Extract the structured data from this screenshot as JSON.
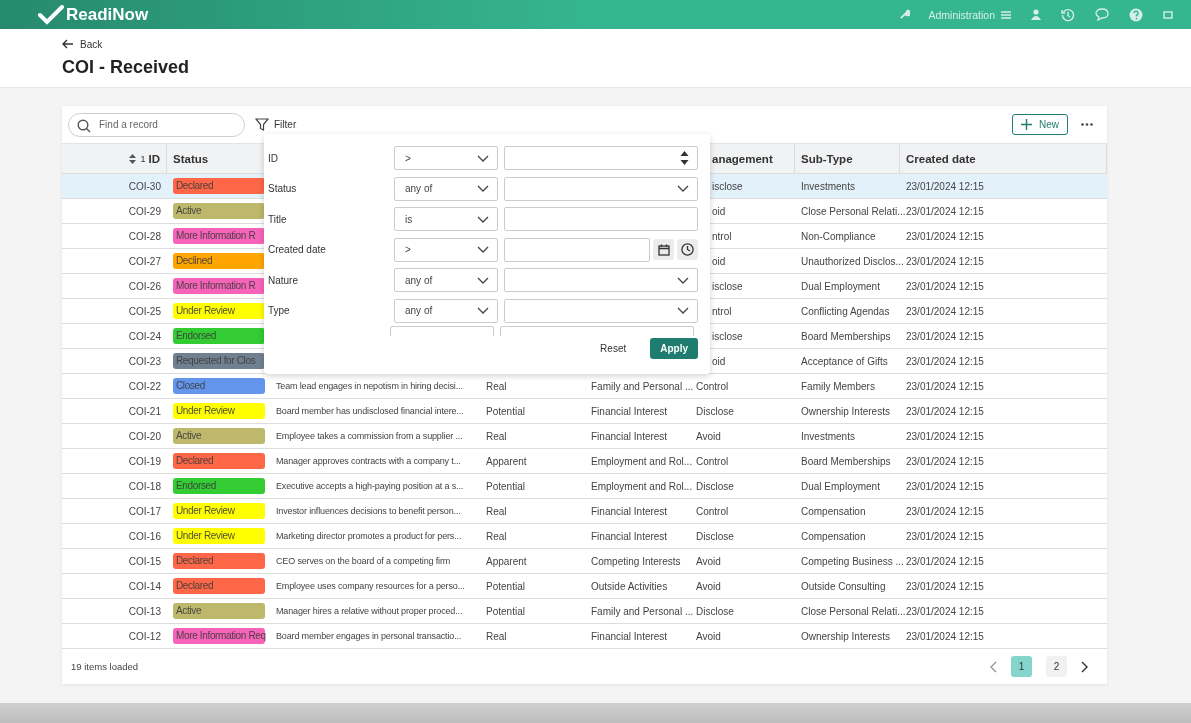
{
  "app": {
    "logo": "ReadiNow",
    "admin_label": "Administration"
  },
  "page": {
    "back": "Back",
    "title": "COI - Received"
  },
  "toolbar": {
    "search_placeholder": "Find a record",
    "filter": "Filter",
    "new": "New"
  },
  "table": {
    "sort_rank": "1",
    "headings": {
      "id": "ID",
      "status": "Status",
      "column_6": "anagement",
      "sub_type": "Sub-Type",
      "created": "Created date"
    },
    "rows": [
      {
        "id": "COI-30",
        "status": "Declared",
        "color": "#fd6647",
        "column_6": "isclose",
        "sub_type": "Investments",
        "created": "23/01/2024 12:15",
        "selected": true
      },
      {
        "id": "COI-29",
        "status": "Active",
        "color": "#bdb86b",
        "column_6": "oid",
        "sub_type": "Close Personal Relati...",
        "created": "23/01/2024 12:15",
        "selected": false
      },
      {
        "id": "COI-28",
        "status": "More Information R",
        "color": "#f763b8",
        "column_6": "ntrol",
        "sub_type": "Non-Compliance",
        "created": "23/01/2024 12:15",
        "selected": false
      },
      {
        "id": "COI-27",
        "status": "Declined",
        "color": "#ffa500",
        "column_6": "oid",
        "sub_type": "Unauthorized Disclos...",
        "created": "23/01/2024 12:15",
        "selected": false
      },
      {
        "id": "COI-26",
        "status": "More Information R",
        "color": "#f763b8",
        "column_6": "isclose",
        "sub_type": "Dual Employment",
        "created": "23/01/2024 12:15",
        "selected": false
      },
      {
        "id": "COI-25",
        "status": "Under Review",
        "color": "#ffff00",
        "column_6": "ntrol",
        "sub_type": "Conflicting Agendas",
        "created": "23/01/2024 12:15",
        "selected": false
      },
      {
        "id": "COI-24",
        "status": "Endorsed",
        "color": "#33cc33",
        "column_6": "isclose",
        "sub_type": "Board Memberships",
        "created": "23/01/2024 12:15",
        "selected": false
      },
      {
        "id": "COI-23",
        "status": "Requested for Clos",
        "color": "#708090",
        "column_6": "oid",
        "sub_type": "Acceptance of Gifts",
        "created": "23/01/2024 12:15",
        "selected": false
      },
      {
        "id": "COI-22",
        "status": "Closed",
        "color": "#6495ed",
        "column_3": "Team lead engages in nepotism in hiring decisi...",
        "column_4": "Real",
        "column_5": "Family and Personal ...",
        "column_6": "Control",
        "sub_type": "Family Members",
        "created": "23/01/2024 12:15",
        "selected": false
      },
      {
        "id": "COI-21",
        "status": "Under Review",
        "color": "#ffff00",
        "column_3": "Board member has undisclosed financial intere...",
        "column_4": "Potential",
        "column_5": "Financial Interest",
        "column_6": "Disclose",
        "sub_type": "Ownership Interests",
        "created": "23/01/2024 12:15",
        "selected": false
      },
      {
        "id": "COI-20",
        "status": "Active",
        "color": "#bdb86b",
        "column_3": "Employee takes a commission from a supplier ...",
        "column_4": "Real",
        "column_5": "Financial Interest",
        "column_6": "Avoid",
        "sub_type": "Investments",
        "created": "23/01/2024 12:15",
        "selected": false
      },
      {
        "id": "COI-19",
        "status": "Declared",
        "color": "#fd6647",
        "column_3": "Manager approves contracts with a company t...",
        "column_4": "Apparent",
        "column_5": "Employment and Rol...",
        "column_6": "Control",
        "sub_type": "Board Memberships",
        "created": "23/01/2024 12:15",
        "selected": false
      },
      {
        "id": "COI-18",
        "status": "Endorsed",
        "color": "#33cc33",
        "column_3": "Executive accepts a high-paying position at a s...",
        "column_4": "Potential",
        "column_5": "Employment and Rol...",
        "column_6": "Disclose",
        "sub_type": "Dual Employment",
        "created": "23/01/2024 12:15",
        "selected": false
      },
      {
        "id": "COI-17",
        "status": "Under Review",
        "color": "#ffff00",
        "column_3": "Investor influences decisions to benefit person...",
        "column_4": "Real",
        "column_5": "Financial Interest",
        "column_6": "Control",
        "sub_type": "Compensation",
        "created": "23/01/2024 12:15",
        "selected": false
      },
      {
        "id": "COI-16",
        "status": "Under Review",
        "color": "#ffff00",
        "column_3": "Marketing director promotes a product for pers...",
        "column_4": "Real",
        "column_5": "Financial Interest",
        "column_6": "Disclose",
        "sub_type": "Compensation",
        "created": "23/01/2024 12:15",
        "selected": false
      },
      {
        "id": "COI-15",
        "status": "Declared",
        "color": "#fd6647",
        "column_3": "CEO serves on the board of a competing firm",
        "column_4": "Apparent",
        "column_5": "Competing Interests",
        "column_6": "Avoid",
        "sub_type": "Competing Business ...",
        "created": "23/01/2024 12:15",
        "selected": false
      },
      {
        "id": "COI-14",
        "status": "Declared",
        "color": "#fd6647",
        "column_3": "Employee uses company resources for a perso...",
        "column_4": "Potential",
        "column_5": "Outside Activities",
        "column_6": "Avoid",
        "sub_type": "Outside Consulting",
        "created": "23/01/2024 12:15",
        "selected": false
      },
      {
        "id": "COI-13",
        "status": "Active",
        "color": "#bdb86b",
        "column_3": "Manager hires a relative without proper proced...",
        "column_4": "Potential",
        "column_5": "Family and Personal ...",
        "column_6": "Disclose",
        "sub_type": "Close Personal Relati...",
        "created": "23/01/2024 12:15",
        "selected": false
      },
      {
        "id": "COI-12",
        "status": "More Information Req",
        "color": "#f763b8",
        "column_3": "Board member engages in personal transactio...",
        "column_4": "Real",
        "column_5": "Financial Interest",
        "column_6": "Avoid",
        "sub_type": "Ownership Interests",
        "created": "23/01/2024 12:15",
        "selected": false
      }
    ]
  },
  "filter_panel": {
    "fields": [
      {
        "label": "ID",
        "operator": ">",
        "kind": "number"
      },
      {
        "label": "Status",
        "operator": "any of",
        "kind": "select"
      },
      {
        "label": "Title",
        "operator": "is",
        "kind": "text"
      },
      {
        "label": "Created date",
        "operator": ">",
        "kind": "datetime"
      },
      {
        "label": "Nature",
        "operator": "any of",
        "kind": "select"
      },
      {
        "label": "Type",
        "operator": "any of",
        "kind": "select"
      }
    ],
    "reset": "Reset",
    "apply": "Apply"
  },
  "footer": {
    "count": "19 items loaded",
    "pages": [
      {
        "label": "1",
        "selected": true
      },
      {
        "label": "2",
        "selected": false
      }
    ]
  }
}
